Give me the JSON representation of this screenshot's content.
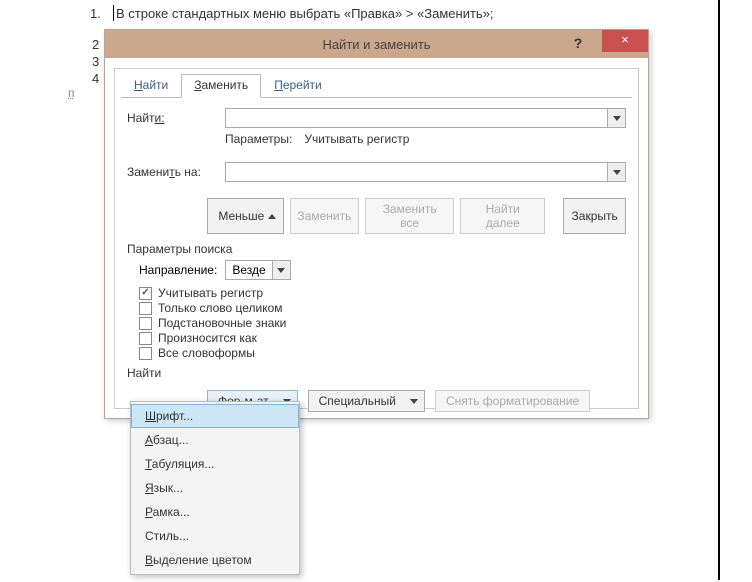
{
  "doc": {
    "line1_num": "1.",
    "line1_text": "В строке стандартных меню выбрать «Правка» > «Заменить»;",
    "nums": [
      "2",
      "3",
      "4"
    ],
    "margin_mark": "п"
  },
  "dialog": {
    "title": "Найти и заменить",
    "help": "?",
    "close": "×",
    "tabs": {
      "find": "айти",
      "find_u": "Н",
      "replace": "аменить",
      "replace_u": "З",
      "goto": "ерейти",
      "goto_u": "П"
    },
    "find_label": "Найт",
    "find_label_u": "и:",
    "find_value": "",
    "params_label": "Параметры:",
    "params_value": "Учитывать регистр",
    "replace_label_a": "Замени",
    "replace_label_u": "т",
    "replace_label_b": "ь на:",
    "replace_value": "",
    "buttons": {
      "less": "Меньше",
      "less_u": "",
      "replace": "Заменить",
      "replace_all": "Заменить все",
      "find_next": "Найти далее",
      "close": "Закрыть"
    },
    "search_params_title": "Параметры поиска",
    "direction_label": "Направление:",
    "direction_value": "Везде",
    "checks": {
      "match_case": "Учитывать регистр",
      "whole_word": "Только слово целиком",
      "wildcards": "Подстановочные знаки",
      "sounds_like": "Произносится как",
      "word_forms": "Все словоформы"
    },
    "find_section": "Найти",
    "format_btn_a": "Фор",
    "format_btn_u": "м",
    "format_btn_b": "ат",
    "special_btn_a": "Специальный",
    "clear_fmt_btn": "Снять форматирование"
  },
  "menu": {
    "items": [
      {
        "u": "Ш",
        "rest": "рифт..."
      },
      {
        "u": "А",
        "rest": "бзац..."
      },
      {
        "u": "Т",
        "rest": "абуляция..."
      },
      {
        "u": "Я",
        "rest": "зык..."
      },
      {
        "u": "Р",
        "rest": "амка..."
      },
      {
        "u": "",
        "rest": "Стиль..."
      },
      {
        "u": "В",
        "rest": "ыделение цветом"
      }
    ]
  }
}
